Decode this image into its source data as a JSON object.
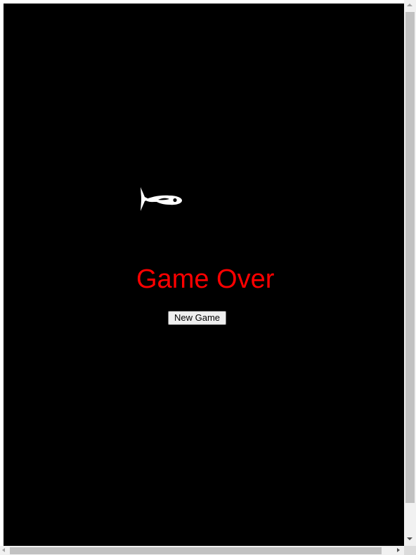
{
  "game": {
    "status_text": "Game Over",
    "new_game_label": "New Game",
    "status_color": "#ff0000",
    "background_color": "#000000",
    "player_icon": "fish-icon"
  }
}
